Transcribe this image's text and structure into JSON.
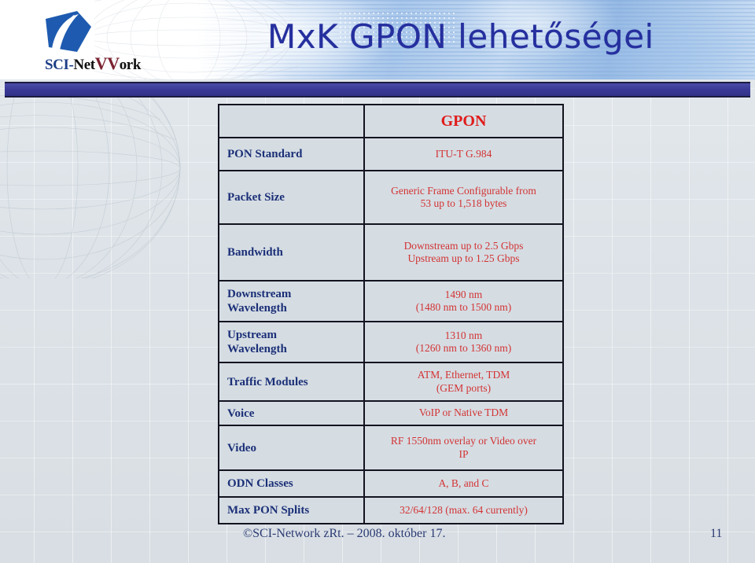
{
  "slide": {
    "title": "MxK GPON lehetőségei",
    "page_number": "11",
    "footer": "©SCI-Network zRt. – 2008. október 17."
  },
  "logo": {
    "text_sci": "SCI-",
    "text_net": "Net",
    "text_w": "VV",
    "text_ork": "ork",
    "mark": "leaf-swoosh-logo"
  },
  "table": {
    "header": {
      "label": "",
      "value": "GPON"
    },
    "rows": [
      {
        "label": "PON Standard",
        "value": "ITU-T G.984"
      },
      {
        "label": "Packet Size",
        "value": "Generic Frame Configurable from 53 up to 1,518 bytes"
      },
      {
        "label": "Bandwidth",
        "value": "Downstream up to 2.5 Gbps Upstream up to 1.25 Gbps"
      },
      {
        "label": "Downstream Wavelength",
        "value": "1490 nm (1480 nm to 1500 nm)"
      },
      {
        "label": "Upstream Wavelength",
        "value": "1310 nm (1260 nm to 1360 nm)"
      },
      {
        "label": "Traffic Modules",
        "value": "ATM, Ethernet, TDM (GEM ports)"
      },
      {
        "label": "Voice",
        "value": "VoIP or Native TDM"
      },
      {
        "label": "Video",
        "value": "RF 1550nm overlay or Video over IP"
      },
      {
        "label": "ODN Classes",
        "value": "A, B, and C"
      },
      {
        "label": "Max PON Splits",
        "value": "32/64/128 (max. 64 currently)"
      }
    ],
    "rows_split": [
      {
        "label_l1": "PON Standard",
        "label_l2": "",
        "value_l1": "ITU-T G.984",
        "value_l2": ""
      },
      {
        "label_l1": "Packet Size",
        "label_l2": "",
        "value_l1": "Generic Frame Configurable from",
        "value_l2": "53 up to 1,518 bytes"
      },
      {
        "label_l1": "Bandwidth",
        "label_l2": "",
        "value_l1": "Downstream up to 2.5 Gbps",
        "value_l2": "Upstream up to 1.25 Gbps"
      },
      {
        "label_l1": "Downstream",
        "label_l2": "Wavelength",
        "value_l1": "1490 nm",
        "value_l2": "(1480 nm to 1500 nm)"
      },
      {
        "label_l1": "Upstream",
        "label_l2": "Wavelength",
        "value_l1": "1310 nm",
        "value_l2": "(1260 nm to 1360 nm)"
      },
      {
        "label_l1": "Traffic Modules",
        "label_l2": "",
        "value_l1": "ATM, Ethernet, TDM",
        "value_l2": "(GEM ports)"
      },
      {
        "label_l1": "Voice",
        "label_l2": "",
        "value_l1": "VoIP or Native TDM",
        "value_l2": ""
      },
      {
        "label_l1": "Video",
        "label_l2": "",
        "value_l1": "RF 1550nm overlay or Video over",
        "value_l2": "IP"
      },
      {
        "label_l1": "ODN Classes",
        "label_l2": "",
        "value_l1": "A, B, and C",
        "value_l2": ""
      },
      {
        "label_l1": "Max PON Splits",
        "label_l2": "",
        "value_l1": "32/64/128 (max. 64 currently)",
        "value_l2": ""
      }
    ]
  },
  "colors": {
    "title": "#252f9e",
    "label": "#1b2f77",
    "value": "#d33333",
    "header_value": "#e01b1b",
    "divider_bar": "#3a3a96",
    "background": "#dfe4e8",
    "table_fill": "#d5dde3",
    "footer": "#2b3a73"
  }
}
